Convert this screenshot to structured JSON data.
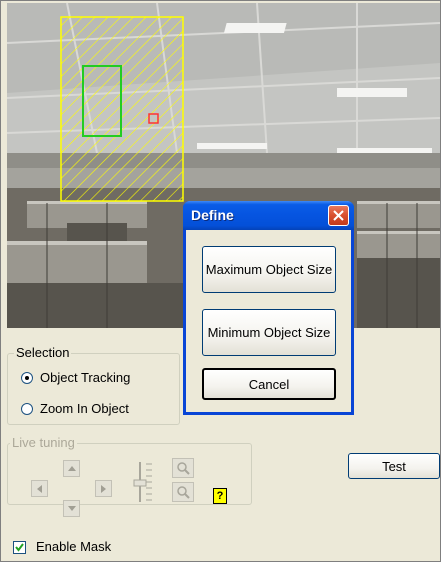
{
  "selection": {
    "title": "Selection",
    "options": [
      {
        "label": "Object Tracking",
        "selected": true
      },
      {
        "label": "Zoom In Object",
        "selected": false
      }
    ]
  },
  "live_tuning": {
    "title": "Live tuning",
    "help_icon": "question-icon"
  },
  "test_button": "Test",
  "enable_mask": {
    "label": "Enable Mask",
    "checked": true
  },
  "dialog": {
    "title": "Define",
    "max_button": "Maximum Object Size",
    "min_button": "Minimum Object Size",
    "cancel_button": "Cancel"
  },
  "colors": {
    "mask_outline": "#ffff00",
    "inner_box": "#22cc22",
    "target_marker": "#ff3333",
    "dialog_title": "#0654e0"
  }
}
